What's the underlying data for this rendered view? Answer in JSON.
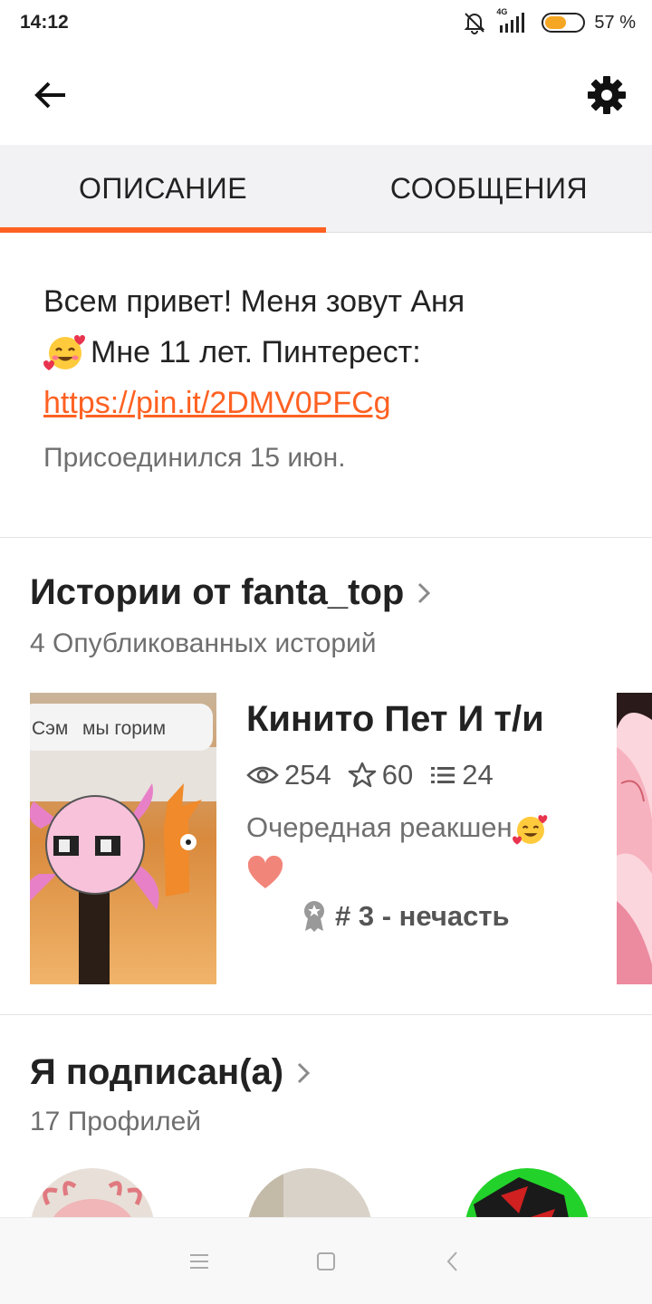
{
  "status_bar": {
    "time": "14:12",
    "network": "4G",
    "battery_text": "57 %",
    "battery_level": 0.57,
    "icons": [
      "muted-bell-icon",
      "signal-icon",
      "battery-icon"
    ]
  },
  "toolbar": {
    "back_icon": "arrow-left-icon",
    "settings_icon": "gear-icon"
  },
  "tabs": [
    {
      "label": "ОПИСАНИЕ",
      "active": true
    },
    {
      "label": "СООБЩЕНИЯ",
      "active": false
    }
  ],
  "profile": {
    "bio_line1": "Всем привет! Меня зовут Аня",
    "bio_line2": " Мне 11 лет. Пинтерест:",
    "bio_emoji": "smiling-face-with-hearts",
    "link": "https://pin.it/2DMV0PFCg",
    "joined": "Присоединился 15 июн."
  },
  "stories_section": {
    "title": "Истории от fanta_top",
    "subtitle": "4 Опубликованных историй",
    "story": {
      "cover_caption_left": "Сэм",
      "cover_caption_right": "мы горим",
      "title": "Кинито Пет И т/и",
      "views": "254",
      "votes": "60",
      "parts": "24",
      "description": "Очередная реакшен",
      "rank": "# 3 - нечасть"
    }
  },
  "following_section": {
    "title": "Я подписан(а)",
    "subtitle": "17 Профилей"
  },
  "colors": {
    "accent": "#ff6122",
    "tab_bg": "#f2f2f4",
    "muted_text": "#6f6f6f"
  }
}
